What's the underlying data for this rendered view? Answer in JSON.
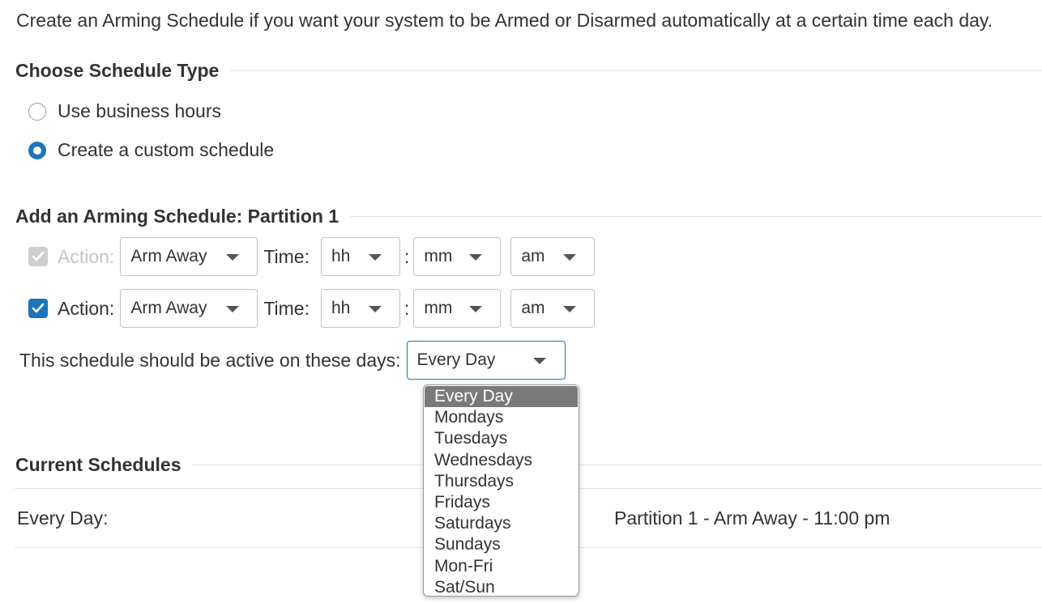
{
  "intro": "Create an Arming Schedule if you want your system to be Armed or Disarmed automatically at a certain time each day.",
  "schedule_type": {
    "title": "Choose Schedule Type",
    "options": [
      {
        "label": "Use business hours",
        "checked": false
      },
      {
        "label": "Create a custom schedule",
        "checked": true
      }
    ]
  },
  "add_schedule": {
    "title": "Add an Arming Schedule: Partition 1",
    "rows": [
      {
        "enabled": false,
        "action_label": "Action:",
        "action_value": "Arm Away",
        "time_label": "Time:",
        "hour": "hh",
        "separator": ":",
        "minute": "mm",
        "ampm": "am"
      },
      {
        "enabled": true,
        "action_label": "Action:",
        "action_value": "Arm Away",
        "time_label": "Time:",
        "hour": "hh",
        "separator": ":",
        "minute": "mm",
        "ampm": "am"
      }
    ],
    "days_label": "This schedule should be active on these days:",
    "days_value": "Every Day",
    "days_options": [
      "Every Day",
      "Mondays",
      "Tuesdays",
      "Wednesdays",
      "Thursdays",
      "Fridays",
      "Saturdays",
      "Sundays",
      "Mon-Fri",
      "Sat/Sun"
    ]
  },
  "current": {
    "title": "Current Schedules",
    "rows": [
      {
        "days": "Every Day:",
        "detail": "Partition 1 - Arm Away - 11:00 pm"
      }
    ]
  },
  "colors": {
    "accent": "#1b75bb",
    "text": "#333333",
    "disabled": "#c5c5c5",
    "dropdown_selected": "#7a7a7a"
  }
}
